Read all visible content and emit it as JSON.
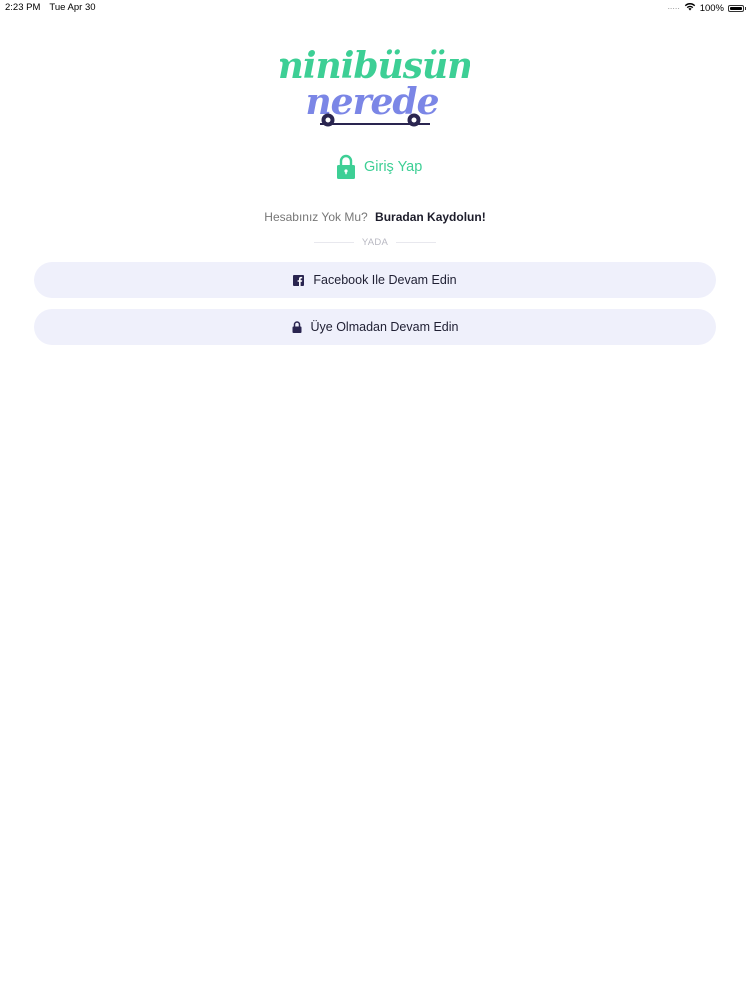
{
  "status_bar": {
    "time": "2:23 PM",
    "date": "Tue Apr 30",
    "battery": "100%",
    "signal_icon": "signal-dots-icon",
    "wifi_icon": "wifi-icon",
    "battery_icon": "battery-icon"
  },
  "logo": {
    "line1": "minibüsüm",
    "line2": "nerede",
    "colors": {
      "line1": "#3dcf95",
      "line2": "#7b86e6"
    }
  },
  "login": {
    "label": "Giriş Yap",
    "icon": "lock-icon",
    "color": "#3dcf95"
  },
  "signup": {
    "question": "Hesabınız Yok Mu?",
    "link": "Buradan Kaydolun!"
  },
  "divider": {
    "text": "YADA"
  },
  "buttons": {
    "facebook": {
      "label": "Facebook Ile Devam Edin",
      "icon": "facebook-icon"
    },
    "guest": {
      "label": "Üye Olmadan Devam Edin",
      "icon": "lock-icon"
    }
  },
  "colors": {
    "accent": "#3dcf95",
    "button_bg": "#eff0fb",
    "text_dark": "#1d1d2b",
    "icon_dark": "#2a2550"
  }
}
